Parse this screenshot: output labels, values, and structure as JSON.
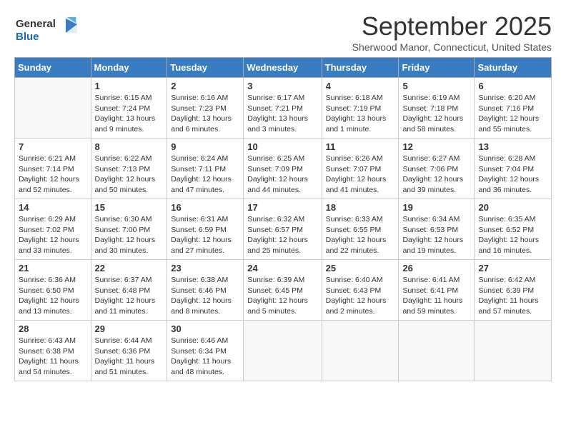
{
  "logo": {
    "text_general": "General",
    "text_blue": "Blue"
  },
  "title": "September 2025",
  "subtitle": "Sherwood Manor, Connecticut, United States",
  "days_of_week": [
    "Sunday",
    "Monday",
    "Tuesday",
    "Wednesday",
    "Thursday",
    "Friday",
    "Saturday"
  ],
  "weeks": [
    [
      {
        "num": "",
        "sunrise": "",
        "sunset": "",
        "daylight": ""
      },
      {
        "num": "1",
        "sunrise": "Sunrise: 6:15 AM",
        "sunset": "Sunset: 7:24 PM",
        "daylight": "Daylight: 13 hours and 9 minutes."
      },
      {
        "num": "2",
        "sunrise": "Sunrise: 6:16 AM",
        "sunset": "Sunset: 7:23 PM",
        "daylight": "Daylight: 13 hours and 6 minutes."
      },
      {
        "num": "3",
        "sunrise": "Sunrise: 6:17 AM",
        "sunset": "Sunset: 7:21 PM",
        "daylight": "Daylight: 13 hours and 3 minutes."
      },
      {
        "num": "4",
        "sunrise": "Sunrise: 6:18 AM",
        "sunset": "Sunset: 7:19 PM",
        "daylight": "Daylight: 13 hours and 1 minute."
      },
      {
        "num": "5",
        "sunrise": "Sunrise: 6:19 AM",
        "sunset": "Sunset: 7:18 PM",
        "daylight": "Daylight: 12 hours and 58 minutes."
      },
      {
        "num": "6",
        "sunrise": "Sunrise: 6:20 AM",
        "sunset": "Sunset: 7:16 PM",
        "daylight": "Daylight: 12 hours and 55 minutes."
      }
    ],
    [
      {
        "num": "7",
        "sunrise": "Sunrise: 6:21 AM",
        "sunset": "Sunset: 7:14 PM",
        "daylight": "Daylight: 12 hours and 52 minutes."
      },
      {
        "num": "8",
        "sunrise": "Sunrise: 6:22 AM",
        "sunset": "Sunset: 7:13 PM",
        "daylight": "Daylight: 12 hours and 50 minutes."
      },
      {
        "num": "9",
        "sunrise": "Sunrise: 6:24 AM",
        "sunset": "Sunset: 7:11 PM",
        "daylight": "Daylight: 12 hours and 47 minutes."
      },
      {
        "num": "10",
        "sunrise": "Sunrise: 6:25 AM",
        "sunset": "Sunset: 7:09 PM",
        "daylight": "Daylight: 12 hours and 44 minutes."
      },
      {
        "num": "11",
        "sunrise": "Sunrise: 6:26 AM",
        "sunset": "Sunset: 7:07 PM",
        "daylight": "Daylight: 12 hours and 41 minutes."
      },
      {
        "num": "12",
        "sunrise": "Sunrise: 6:27 AM",
        "sunset": "Sunset: 7:06 PM",
        "daylight": "Daylight: 12 hours and 39 minutes."
      },
      {
        "num": "13",
        "sunrise": "Sunrise: 6:28 AM",
        "sunset": "Sunset: 7:04 PM",
        "daylight": "Daylight: 12 hours and 36 minutes."
      }
    ],
    [
      {
        "num": "14",
        "sunrise": "Sunrise: 6:29 AM",
        "sunset": "Sunset: 7:02 PM",
        "daylight": "Daylight: 12 hours and 33 minutes."
      },
      {
        "num": "15",
        "sunrise": "Sunrise: 6:30 AM",
        "sunset": "Sunset: 7:00 PM",
        "daylight": "Daylight: 12 hours and 30 minutes."
      },
      {
        "num": "16",
        "sunrise": "Sunrise: 6:31 AM",
        "sunset": "Sunset: 6:59 PM",
        "daylight": "Daylight: 12 hours and 27 minutes."
      },
      {
        "num": "17",
        "sunrise": "Sunrise: 6:32 AM",
        "sunset": "Sunset: 6:57 PM",
        "daylight": "Daylight: 12 hours and 25 minutes."
      },
      {
        "num": "18",
        "sunrise": "Sunrise: 6:33 AM",
        "sunset": "Sunset: 6:55 PM",
        "daylight": "Daylight: 12 hours and 22 minutes."
      },
      {
        "num": "19",
        "sunrise": "Sunrise: 6:34 AM",
        "sunset": "Sunset: 6:53 PM",
        "daylight": "Daylight: 12 hours and 19 minutes."
      },
      {
        "num": "20",
        "sunrise": "Sunrise: 6:35 AM",
        "sunset": "Sunset: 6:52 PM",
        "daylight": "Daylight: 12 hours and 16 minutes."
      }
    ],
    [
      {
        "num": "21",
        "sunrise": "Sunrise: 6:36 AM",
        "sunset": "Sunset: 6:50 PM",
        "daylight": "Daylight: 12 hours and 13 minutes."
      },
      {
        "num": "22",
        "sunrise": "Sunrise: 6:37 AM",
        "sunset": "Sunset: 6:48 PM",
        "daylight": "Daylight: 12 hours and 11 minutes."
      },
      {
        "num": "23",
        "sunrise": "Sunrise: 6:38 AM",
        "sunset": "Sunset: 6:46 PM",
        "daylight": "Daylight: 12 hours and 8 minutes."
      },
      {
        "num": "24",
        "sunrise": "Sunrise: 6:39 AM",
        "sunset": "Sunset: 6:45 PM",
        "daylight": "Daylight: 12 hours and 5 minutes."
      },
      {
        "num": "25",
        "sunrise": "Sunrise: 6:40 AM",
        "sunset": "Sunset: 6:43 PM",
        "daylight": "Daylight: 12 hours and 2 minutes."
      },
      {
        "num": "26",
        "sunrise": "Sunrise: 6:41 AM",
        "sunset": "Sunset: 6:41 PM",
        "daylight": "Daylight: 11 hours and 59 minutes."
      },
      {
        "num": "27",
        "sunrise": "Sunrise: 6:42 AM",
        "sunset": "Sunset: 6:39 PM",
        "daylight": "Daylight: 11 hours and 57 minutes."
      }
    ],
    [
      {
        "num": "28",
        "sunrise": "Sunrise: 6:43 AM",
        "sunset": "Sunset: 6:38 PM",
        "daylight": "Daylight: 11 hours and 54 minutes."
      },
      {
        "num": "29",
        "sunrise": "Sunrise: 6:44 AM",
        "sunset": "Sunset: 6:36 PM",
        "daylight": "Daylight: 11 hours and 51 minutes."
      },
      {
        "num": "30",
        "sunrise": "Sunrise: 6:46 AM",
        "sunset": "Sunset: 6:34 PM",
        "daylight": "Daylight: 11 hours and 48 minutes."
      },
      {
        "num": "",
        "sunrise": "",
        "sunset": "",
        "daylight": ""
      },
      {
        "num": "",
        "sunrise": "",
        "sunset": "",
        "daylight": ""
      },
      {
        "num": "",
        "sunrise": "",
        "sunset": "",
        "daylight": ""
      },
      {
        "num": "",
        "sunrise": "",
        "sunset": "",
        "daylight": ""
      }
    ]
  ]
}
